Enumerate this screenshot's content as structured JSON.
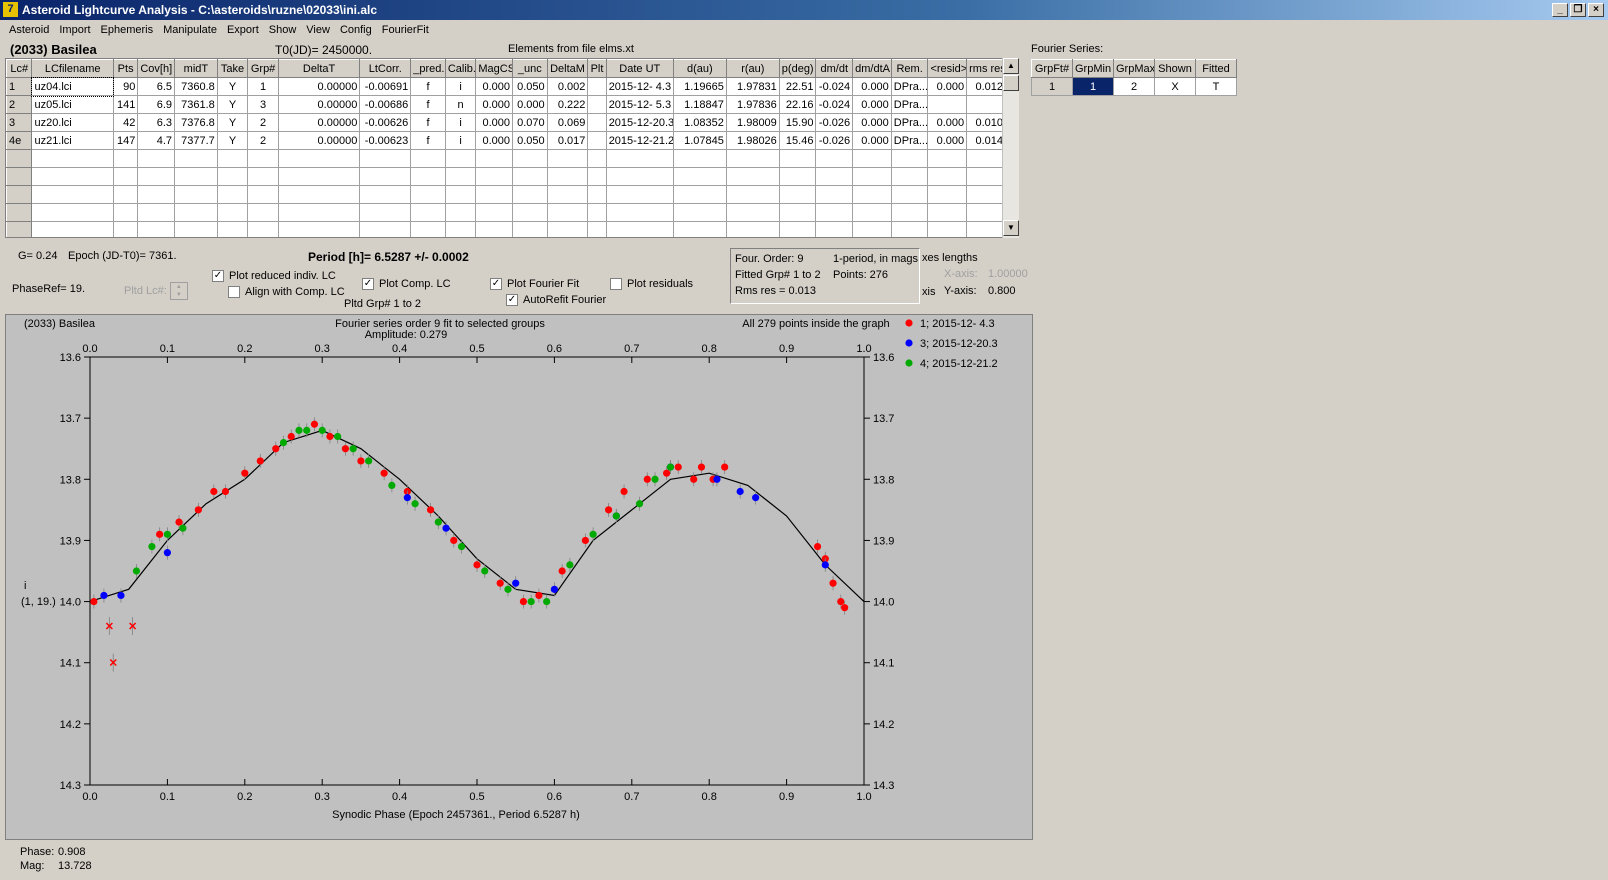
{
  "window": {
    "title": "Asteroid Lightcurve Analysis - C:\\asteroids\\ruzne\\02033\\ini.alc",
    "icon": "7"
  },
  "menu": [
    "Asteroid",
    "Import",
    "Ephemeris",
    "Manipulate",
    "Export",
    "Show",
    "View",
    "Config",
    "FourierFit"
  ],
  "header": {
    "asteroid": "(2033) Basilea",
    "t0": "T0(JD)= 2450000.",
    "elements": "Elements from file elms.xt"
  },
  "lc_table": {
    "columns": [
      "Lc#",
      "LCfilename",
      "Pts",
      "Cov[h]",
      "midT",
      "Take",
      "Grp#",
      "DeltaT",
      "LtCorr.",
      "_pred.",
      "Calib.",
      "MagCS",
      "_unc",
      "DeltaM",
      "Plt",
      "Date UT",
      "d(au)",
      "r(au)",
      "p(deg)",
      "dm/dt",
      "dm/dtA",
      "Rem.",
      "<resid>",
      "rms res"
    ],
    "rows": [
      [
        "1",
        "uz04.lci",
        "90",
        "6.5",
        "7360.8",
        "Y",
        "1",
        "0.00000",
        "-0.00691",
        "f",
        "i",
        "0.000",
        "0.050",
        "0.002",
        "",
        "2015-12- 4.3",
        "1.19665",
        "1.97831",
        "22.51",
        "-0.024",
        "0.000",
        "DPra...",
        "0.000",
        "0.012"
      ],
      [
        "2",
        "uz05.lci",
        "141",
        "6.9",
        "7361.8",
        "Y",
        "3",
        "0.00000",
        "-0.00686",
        "f",
        "n",
        "0.000",
        "0.000",
        "0.222",
        "",
        "2015-12- 5.3",
        "1.18847",
        "1.97836",
        "22.16",
        "-0.024",
        "0.000",
        "DPra...",
        "",
        ""
      ],
      [
        "3",
        "uz20.lci",
        "42",
        "6.3",
        "7376.8",
        "Y",
        "2",
        "0.00000",
        "-0.00626",
        "f",
        "i",
        "0.000",
        "0.070",
        "0.069",
        "",
        "2015-12-20.3",
        "1.08352",
        "1.98009",
        "15.90",
        "-0.026",
        "0.000",
        "DPra...",
        "0.000",
        "0.010"
      ],
      [
        "4e",
        "uz21.lci",
        "147",
        "4.7",
        "7377.7",
        "Y",
        "2",
        "0.00000",
        "-0.00623",
        "f",
        "i",
        "0.000",
        "0.050",
        "0.017",
        "",
        "2015-12-21.2",
        "1.07845",
        "1.98026",
        "15.46",
        "-0.026",
        "0.000",
        "DPra...",
        "0.000",
        "0.014"
      ]
    ]
  },
  "fourier_series": {
    "label": "Fourier Series:",
    "columns": [
      "GrpFt#",
      "GrpMin",
      "GrpMax",
      "Shown",
      "Fitted"
    ],
    "row": [
      "1",
      "1",
      "2",
      "X",
      "T"
    ]
  },
  "controls": {
    "g": "G= 0.24",
    "epoch": "Epoch (JD-T0)= 7361.",
    "period": "Period [h]= 6.5287 +/- 0.0002",
    "phaseref": "PhaseRef= 19.",
    "pltd_lc": "Pltd Lc#:",
    "plot_reduced": "Plot reduced indiv. LC",
    "align_comp": "Align with Comp. LC",
    "plot_comp": "Plot Comp. LC",
    "pltd_grp": "Pltd Grp#  1   to   2",
    "plot_fourier": "Plot Fourier Fit",
    "autorefit": "AutoRefit Fourier",
    "plot_residuals": "Plot residuals"
  },
  "fit_info": {
    "order": "Four. Order:  9",
    "period_mode": "1-period, in mags",
    "fitted_grp": "Fitted Grp# 1 to 2",
    "points": "Points: 276",
    "rms": "Rms res     = 0.013"
  },
  "axes_lengths": {
    "label": "xes lengths",
    "x_label": "X-axis:",
    "x_value": "1.00000",
    "y_label": "Y-axis:",
    "y_value": "0.800",
    "cut": "xis"
  },
  "readout": {
    "phase_label": "Phase:",
    "phase_value": "0.908",
    "mag_label": "Mag:",
    "mag_value": "13.728"
  },
  "chart_data": {
    "type": "scatter",
    "title": "(2033) Basilea",
    "subtitle": "Fourier series order 9 fit to selected groups",
    "amplitude": "Amplitude: 0.279",
    "note": "All 279 points inside the graph",
    "xlabel": "Synodic Phase (Epoch 2457361., Period 6.5287 h)",
    "ylabel": "i",
    "ylabel2": "(1, 19.)",
    "xlim": [
      0.0,
      1.0
    ],
    "ylim": [
      13.6,
      14.3
    ],
    "y_inverted": true,
    "xticks": [
      "0.0",
      "0.1",
      "0.2",
      "0.3",
      "0.4",
      "0.5",
      "0.6",
      "0.7",
      "0.8",
      "0.9",
      "1.0"
    ],
    "yticks": [
      "13.6",
      "13.7",
      "13.8",
      "13.9",
      "14.0",
      "14.1",
      "14.2",
      "14.3"
    ],
    "legend_placement": "top-right outside",
    "series": [
      {
        "name": "1; 2015-12- 4.3",
        "color": "#ff0000",
        "points": [
          [
            0.005,
            14.0
          ],
          [
            0.09,
            13.89
          ],
          [
            0.115,
            13.87
          ],
          [
            0.14,
            13.85
          ],
          [
            0.16,
            13.82
          ],
          [
            0.175,
            13.82
          ],
          [
            0.2,
            13.79
          ],
          [
            0.22,
            13.77
          ],
          [
            0.24,
            13.75
          ],
          [
            0.26,
            13.73
          ],
          [
            0.29,
            13.71
          ],
          [
            0.31,
            13.73
          ],
          [
            0.33,
            13.75
          ],
          [
            0.35,
            13.77
          ],
          [
            0.38,
            13.79
          ],
          [
            0.41,
            13.82
          ],
          [
            0.44,
            13.85
          ],
          [
            0.47,
            13.9
          ],
          [
            0.5,
            13.94
          ],
          [
            0.53,
            13.97
          ],
          [
            0.56,
            14.0
          ],
          [
            0.58,
            13.99
          ],
          [
            0.61,
            13.95
          ],
          [
            0.64,
            13.9
          ],
          [
            0.67,
            13.85
          ],
          [
            0.69,
            13.82
          ],
          [
            0.72,
            13.8
          ],
          [
            0.745,
            13.79
          ],
          [
            0.76,
            13.78
          ],
          [
            0.78,
            13.8
          ],
          [
            0.79,
            13.78
          ],
          [
            0.805,
            13.8
          ],
          [
            0.82,
            13.78
          ],
          [
            0.94,
            13.91
          ],
          [
            0.95,
            13.93
          ],
          [
            0.96,
            13.97
          ],
          [
            0.97,
            14.0
          ],
          [
            0.975,
            14.01
          ]
        ]
      },
      {
        "name": "3; 2015-12-20.3",
        "color": "#0000ff",
        "points": [
          [
            0.018,
            13.99
          ],
          [
            0.04,
            13.99
          ],
          [
            0.1,
            13.92
          ],
          [
            0.41,
            13.83
          ],
          [
            0.46,
            13.88
          ],
          [
            0.55,
            13.97
          ],
          [
            0.6,
            13.98
          ],
          [
            0.68,
            13.86
          ],
          [
            0.75,
            13.78
          ],
          [
            0.81,
            13.8
          ],
          [
            0.84,
            13.82
          ],
          [
            0.86,
            13.83
          ],
          [
            0.95,
            13.94
          ]
        ]
      },
      {
        "name": "4; 2015-12-21.2",
        "color": "#00aa00",
        "points": [
          [
            0.06,
            13.95
          ],
          [
            0.08,
            13.91
          ],
          [
            0.1,
            13.89
          ],
          [
            0.12,
            13.88
          ],
          [
            0.25,
            13.74
          ],
          [
            0.27,
            13.72
          ],
          [
            0.28,
            13.72
          ],
          [
            0.3,
            13.72
          ],
          [
            0.32,
            13.73
          ],
          [
            0.34,
            13.75
          ],
          [
            0.36,
            13.77
          ],
          [
            0.39,
            13.81
          ],
          [
            0.42,
            13.84
          ],
          [
            0.45,
            13.87
          ],
          [
            0.48,
            13.91
          ],
          [
            0.51,
            13.95
          ],
          [
            0.54,
            13.98
          ],
          [
            0.57,
            14.0
          ],
          [
            0.59,
            14.0
          ],
          [
            0.62,
            13.94
          ],
          [
            0.65,
            13.89
          ],
          [
            0.68,
            13.86
          ],
          [
            0.71,
            13.84
          ],
          [
            0.73,
            13.8
          ],
          [
            0.75,
            13.78
          ]
        ]
      }
    ],
    "outliers": [
      [
        0.025,
        14.04
      ],
      [
        0.03,
        14.1
      ],
      [
        0.055,
        14.04
      ]
    ],
    "fit_curve": [
      [
        0.0,
        14.0
      ],
      [
        0.05,
        13.98
      ],
      [
        0.1,
        13.9
      ],
      [
        0.15,
        13.84
      ],
      [
        0.2,
        13.8
      ],
      [
        0.25,
        13.74
      ],
      [
        0.3,
        13.72
      ],
      [
        0.35,
        13.75
      ],
      [
        0.4,
        13.8
      ],
      [
        0.45,
        13.86
      ],
      [
        0.5,
        13.93
      ],
      [
        0.55,
        13.98
      ],
      [
        0.6,
        13.99
      ],
      [
        0.65,
        13.9
      ],
      [
        0.7,
        13.85
      ],
      [
        0.75,
        13.8
      ],
      [
        0.8,
        13.79
      ],
      [
        0.85,
        13.81
      ],
      [
        0.9,
        13.86
      ],
      [
        0.95,
        13.94
      ],
      [
        1.0,
        14.0
      ]
    ]
  }
}
